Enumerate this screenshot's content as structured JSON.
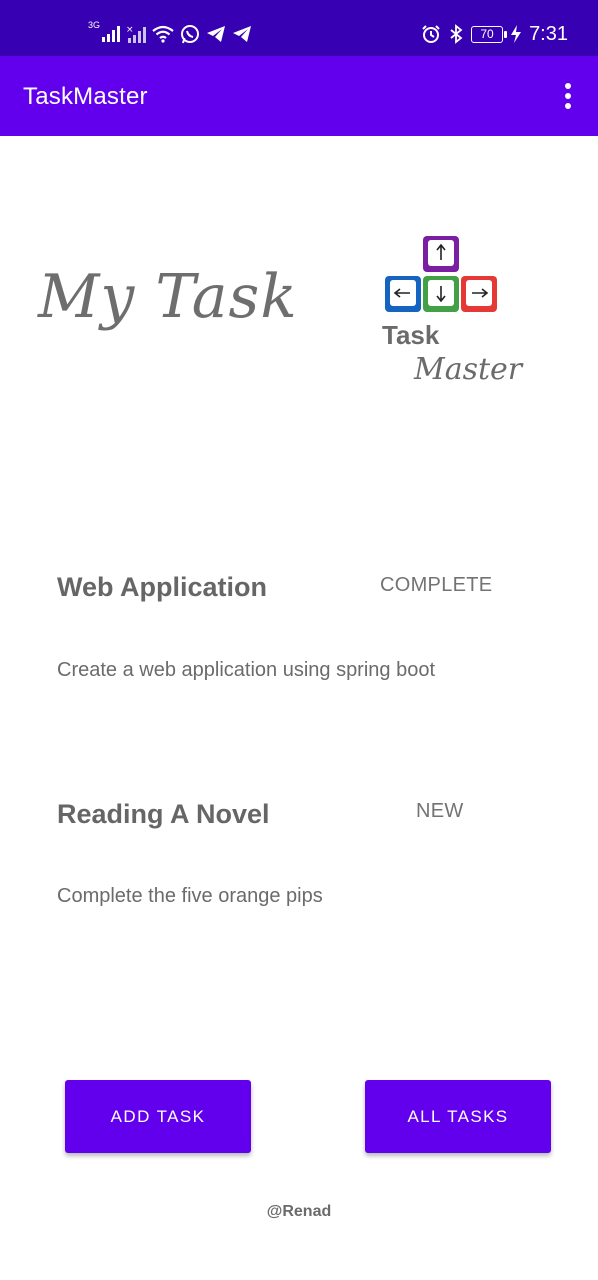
{
  "status_bar": {
    "network_label": "3G",
    "battery_level": "70",
    "time": "7:31",
    "background_color": "#3700b3",
    "icons": [
      "signal-icon",
      "signal-no-data-icon",
      "wifi-icon",
      "whatsapp-icon",
      "telegram-icon",
      "telegram-icon",
      "alarm-icon",
      "bluetooth-icon",
      "battery-icon",
      "charging-icon"
    ]
  },
  "app_bar": {
    "title": "TaskMaster",
    "background_color": "#6200ee",
    "overflow_icon": "more-vert-icon"
  },
  "header": {
    "heading": "My Task",
    "logo": {
      "icon": "taskmaster-logo",
      "text_line1": "Task",
      "text_line2": "Master"
    }
  },
  "tasks": [
    {
      "title": "Web Application",
      "status": "COMPLETE",
      "description": "Create a web application using spring boot"
    },
    {
      "title": "Reading A Novel",
      "status": "NEW",
      "description": "Complete the five orange pips"
    }
  ],
  "buttons": {
    "add_task": "ADD TASK",
    "all_tasks": "ALL TASKS",
    "color": "#6200ee"
  },
  "footer": {
    "credit": "@Renad"
  }
}
